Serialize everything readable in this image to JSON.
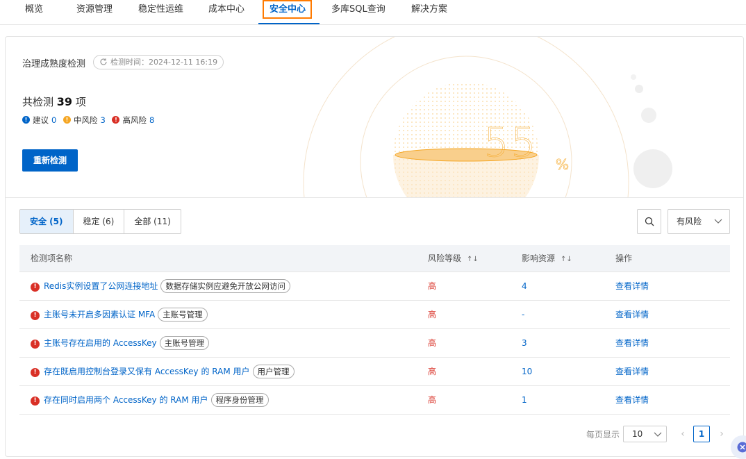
{
  "nav": {
    "items": [
      {
        "label": "概览"
      },
      {
        "label": "资源管理"
      },
      {
        "label": "稳定性运维"
      },
      {
        "label": "成本中心"
      },
      {
        "label": "安全中心"
      },
      {
        "label": "多库SQL查询"
      },
      {
        "label": "解决方案"
      }
    ],
    "active_index": 4
  },
  "hero": {
    "title": "治理成熟度检测",
    "time_label": "检测时间：2024-12-11 16:19",
    "total_prefix": "共检测",
    "total_count": "39",
    "total_suffix": "项",
    "risks": [
      {
        "label": "建议",
        "count": "0",
        "color": "#0064c8",
        "icon": "info-icon"
      },
      {
        "label": "中风险",
        "count": "3",
        "color": "#f5a623",
        "icon": "warning-icon"
      },
      {
        "label": "高风险",
        "count": "8",
        "color": "#d93026",
        "icon": "alert-icon"
      }
    ],
    "recheck_label": "重新检测",
    "score": "55",
    "score_unit": "%"
  },
  "filters": {
    "tabs": [
      {
        "label": "安全 (5)"
      },
      {
        "label": "稳定 (6)"
      },
      {
        "label": "全部 (11)"
      }
    ],
    "active_tab": 0,
    "risk_select": "有风险"
  },
  "table": {
    "columns": [
      "检测项名称",
      "风险等级",
      "影响资源",
      "操作"
    ],
    "rows": [
      {
        "name": "Redis实例设置了公网连接地址",
        "tag": "数据存储实例应避免开放公网访问",
        "level": "高",
        "resources": "4",
        "action": "查看详情"
      },
      {
        "name": "主账号未开启多因素认证 MFA",
        "tag": "主账号管理",
        "level": "高",
        "resources": "-",
        "action": "查看详情"
      },
      {
        "name": "主账号存在启用的 AccessKey",
        "tag": "主账号管理",
        "level": "高",
        "resources": "3",
        "action": "查看详情"
      },
      {
        "name": "存在既启用控制台登录又保有 AccessKey 的 RAM 用户",
        "tag": "用户管理",
        "level": "高",
        "resources": "10",
        "action": "查看详情"
      },
      {
        "name": "存在同时启用两个 AccessKey 的 RAM 用户",
        "tag": "程序身份管理",
        "level": "高",
        "resources": "1",
        "action": "查看详情"
      }
    ]
  },
  "pagination": {
    "page_size_label": "每页显示",
    "page_size": "10",
    "current_page": "1"
  },
  "colors": {
    "accent": "#0064c8",
    "highlight_box": "#ff7a00",
    "danger": "#d93026",
    "gauge": "#f5a623"
  }
}
